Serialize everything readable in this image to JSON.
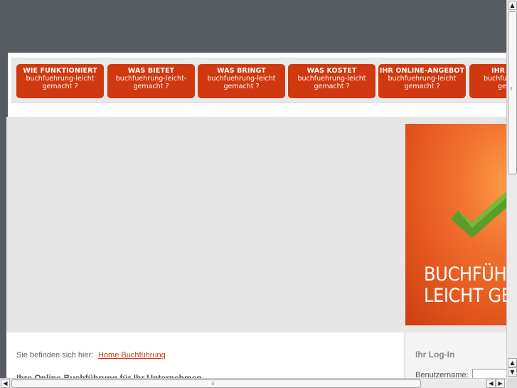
{
  "nav": [
    {
      "title": "WIE FUNKTIONIERT",
      "sub1": "buchfuehrung-leicht",
      "sub2": "gemacht ?"
    },
    {
      "title": "WAS BIETET",
      "sub1": "buchfuehrung-leicht-",
      "sub2": "gemacht ?"
    },
    {
      "title": "WAS BRINGT",
      "sub1": "buchfuehrung-leicht",
      "sub2": "gemacht ?"
    },
    {
      "title": "WAS KOSTET",
      "sub1": "buchfuehrung-leicht",
      "sub2": "gemacht ?"
    },
    {
      "title": "IHR ONLINE-ANGEBOT",
      "sub1": "buchfuehrung-leicht",
      "sub2": "gemacht ?"
    },
    {
      "title": "IHR I",
      "sub1": "buchfu",
      "sub2": "ge"
    }
  ],
  "banner": {
    "line1": "BUCHFÜH",
    "line2": "LEICHT GE"
  },
  "breadcrumb": {
    "label": "Sie befinden sich hier:",
    "link": "Home Buchführung"
  },
  "main": {
    "headline": "Ihre Online-Buchführung für Ihr Unternehmen"
  },
  "login": {
    "title": "Ihr Log-In",
    "username_label": "Benutzername:"
  },
  "colors": {
    "accent": "#d0390f",
    "background": "#575c63",
    "content_bg": "#e6e6e6"
  },
  "icons": [
    "checkmark-logo-icon",
    "scroll-up-icon",
    "scroll-down-icon",
    "scroll-left-icon",
    "scroll-right-icon"
  ]
}
